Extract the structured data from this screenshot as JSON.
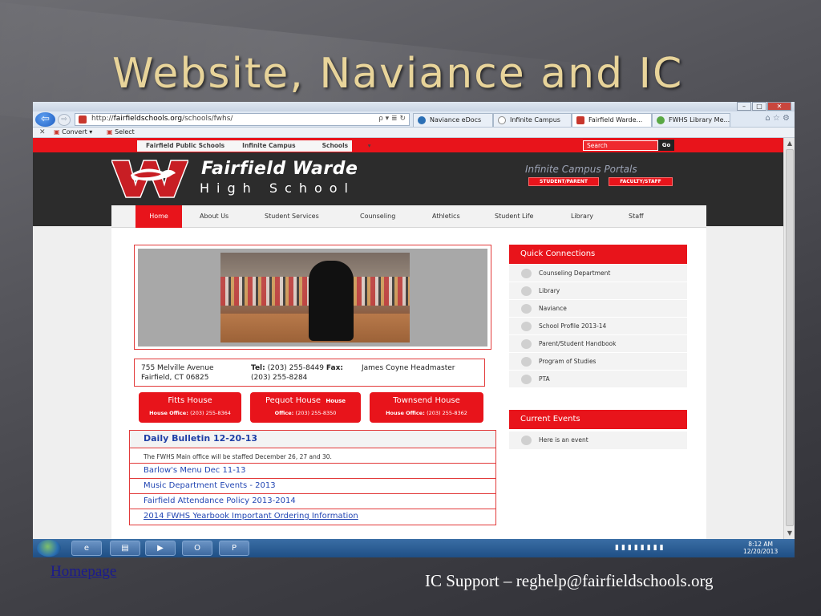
{
  "slide": {
    "title": "Website, Naviance and IC",
    "link_text": "Homepage",
    "footer": "IC Support – reghelp@fairfieldschools.org"
  },
  "browser": {
    "url_prefix": "http://",
    "url_domain": "fairfieldschools.org",
    "url_path": "/schools/fwhs/",
    "url_tools": "ρ ▾ ≣ ↻",
    "tabs": [
      {
        "label": "Naviance eDocs",
        "icon": "naviance-icon",
        "active": false
      },
      {
        "label": "Infinite Campus",
        "icon": "campus-icon",
        "active": false
      },
      {
        "label": "Fairfield Warde...",
        "icon": "school-icon",
        "active": true
      },
      {
        "label": "FWHS Library Me...",
        "icon": "library-icon",
        "active": false
      }
    ],
    "command_bar": {
      "convert": "Convert",
      "select": "Select"
    }
  },
  "site": {
    "top_nav": [
      "Fairfield Public Schools",
      "Infinite Campus",
      "Schools"
    ],
    "search_placeholder": "Search",
    "search_button": "Go",
    "school_name_line1": "Fairfield Warde",
    "school_name_line2": "High School",
    "portals_title": "Infinite Campus Portals",
    "portal_buttons": [
      "STUDENT/PARENT",
      "FACULTY/STAFF"
    ],
    "main_nav": [
      "Home",
      "About Us",
      "Student Services",
      "Counseling",
      "Athletics",
      "Student Life",
      "Library",
      "Staff"
    ],
    "address_line1": "755 Melville Avenue",
    "address_line2": "Fairfield, CT 06825",
    "tel_label": "Tel:",
    "tel_value": "(203) 255-8449",
    "fax_label": "Fax:",
    "fax_value": "(203) 255-8284",
    "headmaster": "James Coyne Headmaster",
    "houses": [
      {
        "name": "Fitts House",
        "extra": "",
        "office_label": "House Office:",
        "office_phone": "(203) 255-8364"
      },
      {
        "name": "Pequot House",
        "extra": "House",
        "office_label": "Office:",
        "office_phone": "(203) 255-8350"
      },
      {
        "name": "Townsend House",
        "extra": "",
        "office_label": "House Office:",
        "office_phone": "(203) 255-8362"
      }
    ],
    "bulletin": {
      "title": "Daily Bulletin 12-20-13",
      "note": "The FWHS Main office will be staffed December 26, 27 and 30.",
      "links": [
        "Barlow's Menu Dec 11-13",
        "Music Department Events - 2013",
        "Fairfield Attendance Policy 2013-2014",
        "2014 FWHS Yearbook Important Ordering Information"
      ]
    },
    "quick_connections_title": "Quick Connections",
    "quick_connections": [
      "Counseling Department",
      "Library",
      "Naviance",
      "School Profile 2013-14",
      "Parent/Student Handbook",
      "Program of Studies",
      "PTA"
    ],
    "current_events_title": "Current Events",
    "current_events": [
      "Here is an event"
    ]
  },
  "taskbar": {
    "time": "8:12 AM",
    "date": "12/20/2013"
  },
  "colors": {
    "brand_red": "#e8141b",
    "header_dark": "#2c2c2c",
    "link_blue": "#2246b3",
    "title_gold": "#e8d49a"
  }
}
